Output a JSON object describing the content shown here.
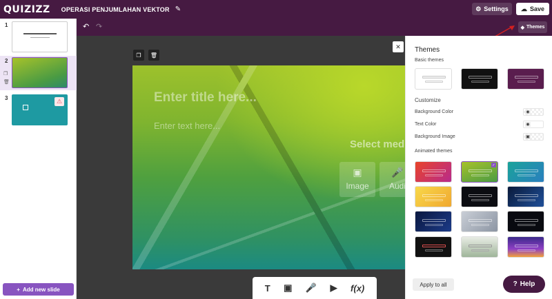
{
  "header": {
    "logo": "QUIZIZZ",
    "doc_title": "OPERASI PENJUMLAHAN VEKTOR",
    "settings_label": "Settings",
    "save_label": "Save"
  },
  "sidebar": {
    "slides": [
      {
        "number": "1"
      },
      {
        "number": "2"
      },
      {
        "number": "3"
      }
    ],
    "add_slide_label": "Add new slide"
  },
  "toolbar": {
    "themes_label": "Themes"
  },
  "slide": {
    "title_placeholder": "Enter title here...",
    "text_placeholder": "Enter text here...",
    "select_media": "Select med",
    "media": [
      {
        "label": "Image",
        "icon": "image-icon"
      },
      {
        "label": "Audi",
        "icon": "microphone-icon"
      }
    ]
  },
  "bottom_tools": [
    "text-icon",
    "image-icon",
    "microphone-icon",
    "video-icon",
    "formula-icon"
  ],
  "panel": {
    "title": "Themes",
    "basic_label": "Basic themes",
    "customize_label": "Customize",
    "bg_color_label": "Background Color",
    "text_color_label": "Text Color",
    "bg_image_label": "Background Image",
    "animated_label": "Animated themes",
    "apply_label": "Apply to all"
  },
  "help_label": "Help",
  "colors": {
    "brand": "#461a42",
    "accent": "#8854c0",
    "slide_bg": "#7fb42f"
  }
}
